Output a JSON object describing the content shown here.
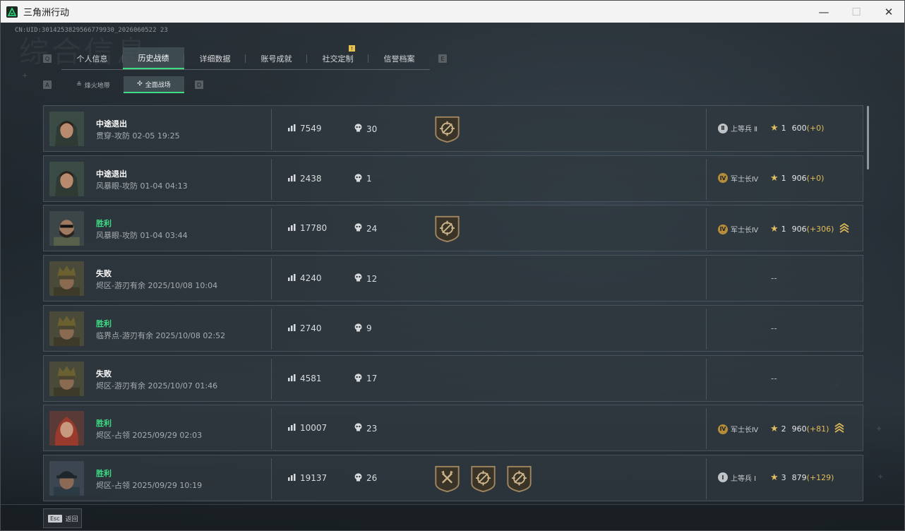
{
  "window": {
    "title": "三角洲行动",
    "min": "—",
    "max": "☐",
    "close": "✕"
  },
  "page": {
    "heading_bg": "综合信息",
    "uid": "CN:UID:3014253829566779930_2026060522 23",
    "tabs": [
      {
        "label": "个人信息"
      },
      {
        "label": "历史战绩"
      },
      {
        "label": "详细数据"
      },
      {
        "label": "账号成就"
      },
      {
        "label": "社交定制"
      },
      {
        "label": "信誉档案"
      }
    ],
    "tab_badge": "!",
    "tab_active": 1,
    "key_hints": {
      "left": "Q",
      "right": "E",
      "sub_left": "A",
      "sub_right": "D"
    },
    "subtabs": [
      {
        "label": "烽火地带",
        "icon": "beacon-icon"
      },
      {
        "label": "全面战场",
        "icon": "battlefield-icon"
      }
    ],
    "subtab_active": 1,
    "esc": {
      "key": "Esc",
      "label": "返回"
    }
  },
  "matches": [
    {
      "result": "中途退出",
      "win": false,
      "map": "贯穿-攻防 02-05 19:25",
      "score": "7549",
      "kills": "30",
      "medals": [
        "target"
      ],
      "rank": {
        "icon": "Ⅱ",
        "name": "上等兵 Ⅱ",
        "level": "1",
        "points": "600",
        "delta": "(+0)",
        "chevrons": false,
        "gray": true
      },
      "avatar": "female-soldier-hood"
    },
    {
      "result": "中途退出",
      "win": false,
      "map": "风暴眼-攻防 01-04 04:13",
      "score": "2438",
      "kills": "1",
      "medals": [],
      "rank": {
        "icon": "Ⅳ",
        "name": "军士长Ⅳ",
        "level": "1",
        "points": "906",
        "delta": "(+0)",
        "chevrons": false
      },
      "avatar": "female-soldier-hood"
    },
    {
      "result": "胜利",
      "win": true,
      "map": "风暴眼-攻防 01-04 03:44",
      "score": "17780",
      "kills": "24",
      "medals": [
        "target"
      ],
      "rank": {
        "icon": "Ⅳ",
        "name": "军士长Ⅳ",
        "level": "1",
        "points": "906",
        "delta": "(+306)",
        "chevrons": true
      },
      "avatar": "male-soldier-beard"
    },
    {
      "result": "失败",
      "win": false,
      "map": "烬区-游刃有余 2025/10/08 10:04",
      "score": "4240",
      "kills": "12",
      "medals": [],
      "rank": null,
      "avatar": "helmet-soldier"
    },
    {
      "result": "胜利",
      "win": true,
      "map": "临界点-游刃有余 2025/10/08 02:52",
      "score": "2740",
      "kills": "9",
      "medals": [],
      "rank": null,
      "avatar": "helmet-soldier"
    },
    {
      "result": "失败",
      "win": false,
      "map": "烬区-游刃有余 2025/10/07 01:46",
      "score": "4581",
      "kills": "17",
      "medals": [],
      "rank": null,
      "avatar": "helmet-soldier"
    },
    {
      "result": "胜利",
      "win": true,
      "map": "烬区-占领 2025/09/29 02:03",
      "score": "10007",
      "kills": "23",
      "medals": [],
      "rank": {
        "icon": "Ⅳ",
        "name": "军士长Ⅳ",
        "level": "2",
        "points": "960",
        "delta": "(+81)",
        "chevrons": true
      },
      "avatar": "red-hair-woman"
    },
    {
      "result": "胜利",
      "win": true,
      "map": "烬区-占领 2025/09/29 10:19",
      "score": "19137",
      "kills": "26",
      "medals": [
        "axes",
        "target",
        "target"
      ],
      "rank": {
        "icon": "Ⅰ",
        "name": "上等兵 Ⅰ",
        "level": "3",
        "points": "879",
        "delta": "(+129)",
        "chevrons": false,
        "gray": true
      },
      "avatar": "cap-soldier"
    }
  ],
  "empty_rank": "--",
  "colors": {
    "win": "#3ddc84",
    "accent": "#3ddc84",
    "gold": "#e3bc5a"
  }
}
